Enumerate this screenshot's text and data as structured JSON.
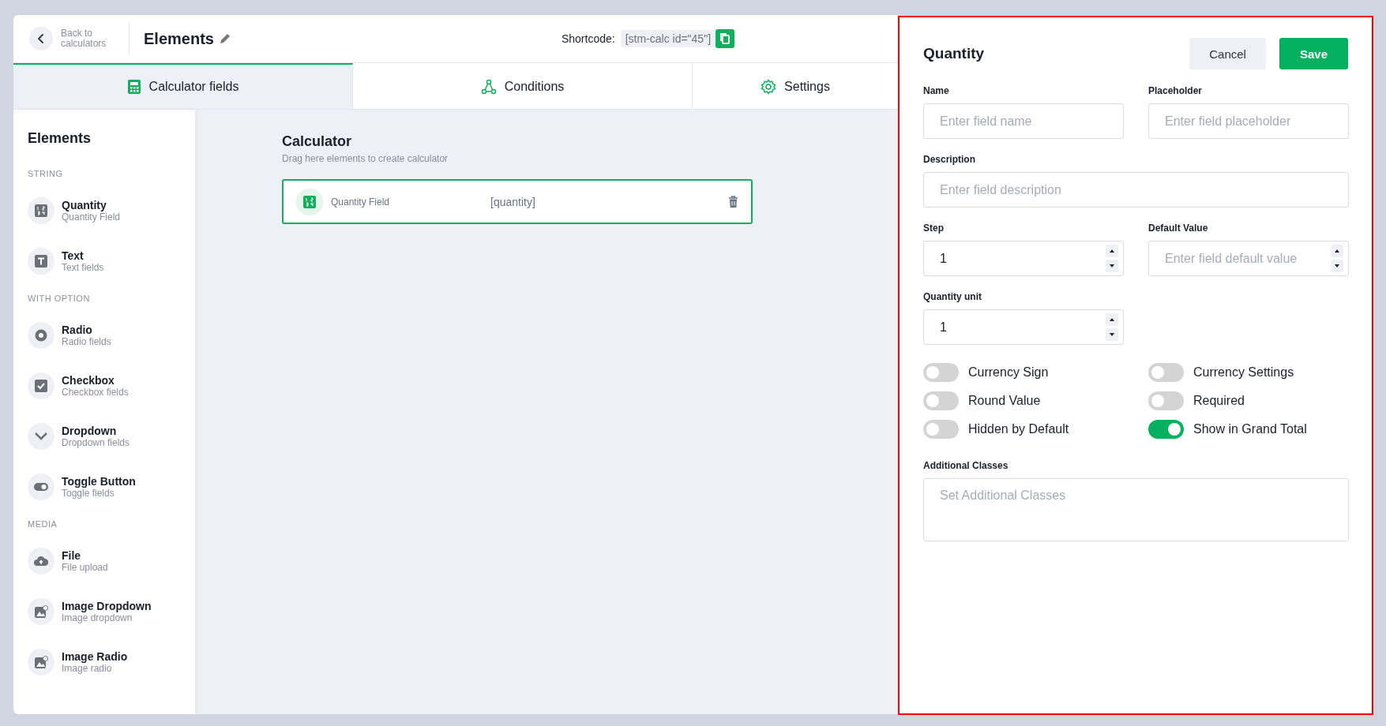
{
  "header": {
    "back_label": "Back to calculators",
    "title": "Elements",
    "shortcode_label": "Shortcode:",
    "shortcode": "[stm-calc id=\"45\"]"
  },
  "tabs": [
    {
      "label": "Calculator fields",
      "kind": "fields",
      "selected": true
    },
    {
      "label": "Conditions",
      "kind": "conditions",
      "selected": false
    },
    {
      "label": "Settings",
      "kind": "settings",
      "selected": false
    }
  ],
  "sidebar": {
    "title": "Elements",
    "groups": [
      {
        "heading": "STRING",
        "items": [
          {
            "title": "Quantity",
            "subtitle": "Quantity Field",
            "kind": "quantity"
          },
          {
            "title": "Text",
            "subtitle": "Text fields",
            "kind": "text"
          }
        ]
      },
      {
        "heading": "WITH OPTION",
        "items": [
          {
            "title": "Radio",
            "subtitle": "Radio fields",
            "kind": "radio"
          },
          {
            "title": "Checkbox",
            "subtitle": "Checkbox fields",
            "kind": "checkbox"
          },
          {
            "title": "Dropdown",
            "subtitle": "Dropdown fields",
            "kind": "dropdown"
          },
          {
            "title": "Toggle Button",
            "subtitle": "Toggle fields",
            "kind": "toggle"
          }
        ]
      },
      {
        "heading": "MEDIA",
        "items": [
          {
            "title": "File",
            "subtitle": "File upload",
            "kind": "file"
          },
          {
            "title": "Image Dropdown",
            "subtitle": "Image dropdown",
            "kind": "image"
          },
          {
            "title": "Image Radio",
            "subtitle": "Image radio",
            "kind": "image"
          }
        ]
      }
    ]
  },
  "canvas": {
    "title": "Calculator",
    "subtitle": "Drag here elements to create calculator",
    "fields": [
      {
        "label": "Quantity Field",
        "code": "[quantity]"
      }
    ]
  },
  "panel": {
    "title": "Quantity",
    "buttons": [
      {
        "label": "Cancel",
        "kind": "secondary"
      },
      {
        "label": "Save",
        "kind": "primary"
      }
    ],
    "fields": [
      {
        "label": "Name",
        "kind": "text",
        "placeholder": "Enter field name"
      },
      {
        "label": "Placeholder",
        "kind": "text",
        "placeholder": "Enter field placeholder"
      },
      {
        "label": "Description",
        "kind": "wide",
        "placeholder": "Enter field description"
      },
      {
        "label": "Step",
        "kind": "number",
        "value": "1"
      },
      {
        "label": "Default Value",
        "kind": "number",
        "placeholder": "Enter field default value"
      },
      {
        "label": "Quantity unit",
        "kind": "number",
        "value": "1"
      }
    ],
    "toggles": [
      {
        "label": "Currency Sign",
        "on": false
      },
      {
        "label": "Currency Settings",
        "on": false
      },
      {
        "label": "Round Value",
        "on": false
      },
      {
        "label": "Required",
        "on": false
      },
      {
        "label": "Hidden by Default",
        "on": false
      },
      {
        "label": "Show in Grand Total",
        "on": true
      }
    ],
    "classes_field": {
      "label": "Additional Classes",
      "placeholder": "Set Additional Classes"
    }
  }
}
